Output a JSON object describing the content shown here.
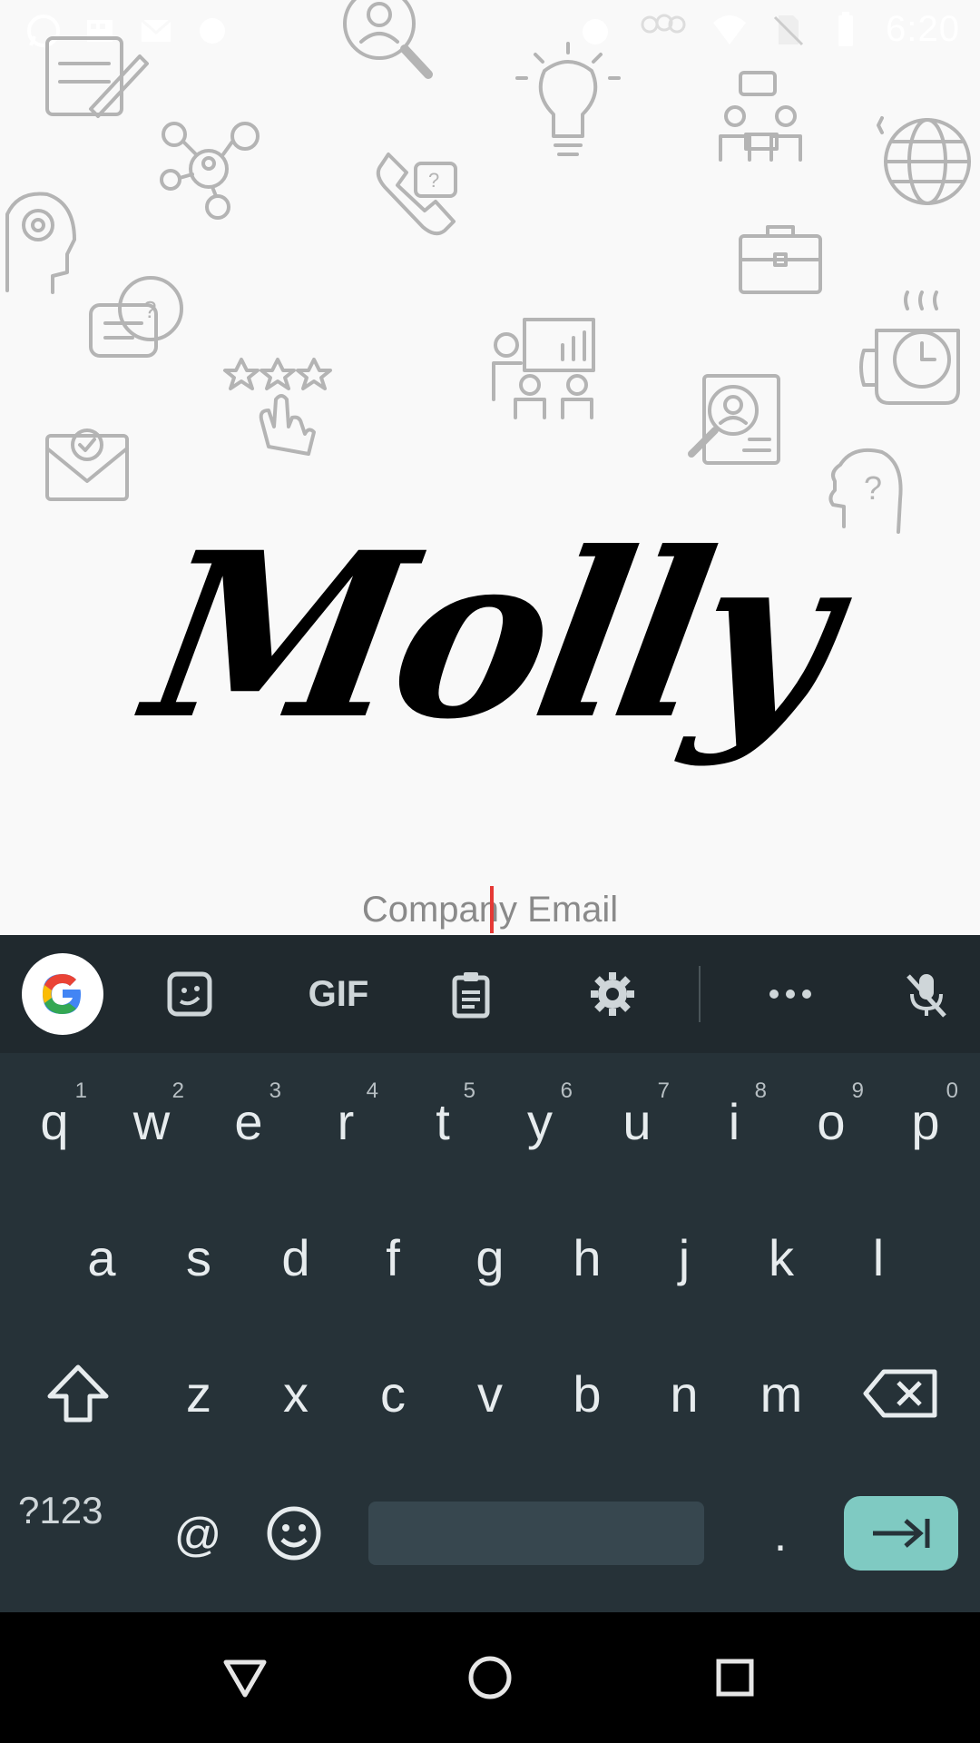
{
  "status_bar": {
    "time": "6:20",
    "left_icons": [
      "whatsapp-icon",
      "storage-icon",
      "gmail-icon",
      "sync-icon"
    ],
    "right_icons": [
      "alarm-icon",
      "community-icon",
      "wifi-icon",
      "no-sim-icon",
      "battery-icon"
    ]
  },
  "app": {
    "logo_text": "Molly",
    "email_placeholder": "Company Email"
  },
  "keyboard": {
    "toolbar": [
      "google-icon",
      "sticker-icon",
      "GIF",
      "clipboard-icon",
      "settings-icon",
      "more-icon",
      "mic-off-icon"
    ],
    "row1": [
      {
        "k": "q",
        "h": "1"
      },
      {
        "k": "w",
        "h": "2"
      },
      {
        "k": "e",
        "h": "3"
      },
      {
        "k": "r",
        "h": "4"
      },
      {
        "k": "t",
        "h": "5"
      },
      {
        "k": "y",
        "h": "6"
      },
      {
        "k": "u",
        "h": "7"
      },
      {
        "k": "i",
        "h": "8"
      },
      {
        "k": "o",
        "h": "9"
      },
      {
        "k": "p",
        "h": "0"
      }
    ],
    "row2": [
      "a",
      "s",
      "d",
      "f",
      "g",
      "h",
      "j",
      "k",
      "l"
    ],
    "row3": [
      "z",
      "x",
      "c",
      "v",
      "b",
      "n",
      "m"
    ],
    "bottom": {
      "symbols": "?123",
      "at": "@",
      "period": "."
    }
  },
  "nav": [
    "back-icon",
    "home-icon",
    "recents-icon"
  ]
}
